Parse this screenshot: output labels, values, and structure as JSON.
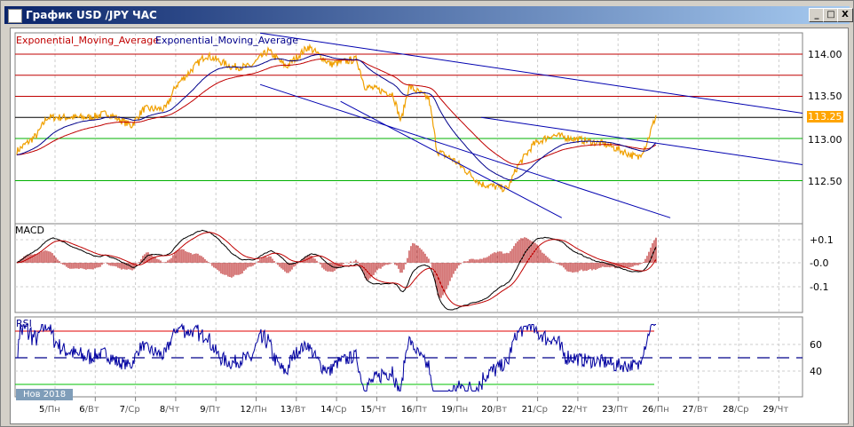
{
  "window": {
    "title": "График USD /JPY  ЧАС",
    "buttons": {
      "minimize": "_",
      "maximize": "□",
      "close": "X"
    }
  },
  "main_panel": {
    "legend": [
      {
        "text": "Exponential_Moving_Average",
        "color": "#c00000"
      },
      {
        "text": "Exponential_Moving_Average",
        "color": "#00008b"
      }
    ],
    "price_ticks": [
      "114.00",
      "113.50",
      "113.00",
      "112.50"
    ],
    "current_price": "113.25"
  },
  "macd_panel": {
    "label": "MACD",
    "ticks": [
      "+0.1",
      "-0.0",
      "-0.1"
    ]
  },
  "rsi_panel": {
    "label": "RSI",
    "ticks": [
      "60",
      "40"
    ],
    "month_badge": "Нов 2018"
  },
  "x_axis": [
    {
      "d": "5",
      "w": "Пн"
    },
    {
      "d": "6",
      "w": "Вт"
    },
    {
      "d": "7",
      "w": "Ср"
    },
    {
      "d": "8",
      "w": "Чт"
    },
    {
      "d": "9",
      "w": "Пт"
    },
    {
      "d": "12",
      "w": "Пн"
    },
    {
      "d": "13",
      "w": "Вт"
    },
    {
      "d": "14",
      "w": "Ср"
    },
    {
      "d": "15",
      "w": "Чт"
    },
    {
      "d": "16",
      "w": "Пт"
    },
    {
      "d": "19",
      "w": "Пн"
    },
    {
      "d": "20",
      "w": "Вт"
    },
    {
      "d": "21",
      "w": "Ср"
    },
    {
      "d": "22",
      "w": "Чт"
    },
    {
      "d": "23",
      "w": "Пт"
    },
    {
      "d": "26",
      "w": "Пн"
    },
    {
      "d": "27",
      "w": "Вт"
    },
    {
      "d": "28",
      "w": "Ср"
    },
    {
      "d": "29",
      "w": "Чт"
    }
  ],
  "chart_data": {
    "type": "line",
    "title": "USD/JPY hourly",
    "ylim": [
      112.1,
      114.3
    ],
    "price_keypoints_dayindex": [
      [
        -0.95,
        112.85
      ],
      [
        -0.45,
        113.04
      ],
      [
        -0.2,
        113.25
      ],
      [
        0.9,
        113.25
      ],
      [
        1.3,
        113.3
      ],
      [
        1.9,
        113.15
      ],
      [
        2.2,
        113.35
      ],
      [
        2.75,
        113.35
      ],
      [
        3.0,
        113.62
      ],
      [
        3.75,
        113.99
      ],
      [
        4.4,
        113.85
      ],
      [
        4.85,
        113.85
      ],
      [
        5.3,
        114.04
      ],
      [
        5.75,
        113.85
      ],
      [
        6.3,
        114.09
      ],
      [
        6.85,
        113.88
      ],
      [
        7.5,
        113.94
      ],
      [
        7.7,
        113.62
      ],
      [
        8.4,
        113.53
      ],
      [
        8.6,
        113.2
      ],
      [
        8.8,
        113.62
      ],
      [
        9.3,
        113.47
      ],
      [
        9.5,
        112.85
      ],
      [
        9.9,
        112.75
      ],
      [
        10.6,
        112.46
      ],
      [
        11.25,
        112.4
      ],
      [
        11.5,
        112.67
      ],
      [
        11.9,
        112.93
      ],
      [
        12.35,
        113.04
      ],
      [
        13.0,
        112.99
      ],
      [
        13.7,
        112.93
      ],
      [
        14.5,
        112.77
      ],
      [
        14.7,
        112.93
      ],
      [
        14.95,
        113.28
      ]
    ],
    "horizontal_levels": [
      {
        "price": 114.0,
        "color": "#c00000"
      },
      {
        "price": 113.75,
        "color": "#c00000"
      },
      {
        "price": 113.5,
        "color": "#c00000"
      },
      {
        "price": 113.25,
        "color": "#000000"
      },
      {
        "price": 113.0,
        "color": "#00b000"
      },
      {
        "price": 112.5,
        "color": "#00b000"
      }
    ],
    "trend_lines": [
      [
        [
          5.1,
          114.25
        ],
        [
          18.6,
          113.3
        ]
      ],
      [
        [
          5.1,
          113.64
        ],
        [
          15.3,
          112.06
        ]
      ],
      [
        [
          7.1,
          113.44
        ],
        [
          12.6,
          112.06
        ]
      ],
      [
        [
          10.6,
          113.25
        ],
        [
          18.6,
          112.69
        ]
      ]
    ],
    "rsi_levels": [
      70,
      50,
      30
    ]
  }
}
